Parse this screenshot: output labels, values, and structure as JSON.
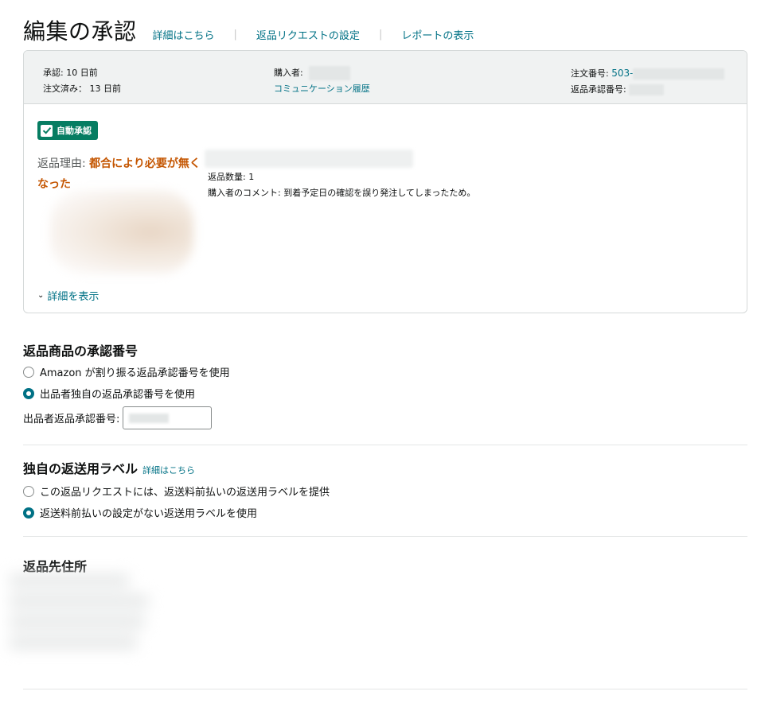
{
  "header": {
    "title": "編集の承認",
    "links": [
      "詳細はこちら",
      "返品リクエストの設定",
      "レポートの表示"
    ]
  },
  "card": {
    "approved": "承認: 10 日前",
    "ordered": "注文済み： 13 日前",
    "buyer_label": "購入者:",
    "communication_link": "コミュニケーション履歴",
    "order_number_label": "注文番号:",
    "order_number_prefix": "503-",
    "rma_label": "返品承認番号:",
    "badge": "自動承認",
    "reason_label": "返品理由:",
    "reason_value": "都合により必要が無くなった",
    "quantity": "返品数量: 1",
    "comment": "購入者のコメント: 到着予定日の確認を誤り発注してしまったため。",
    "show_details": "詳細を表示"
  },
  "rma_section": {
    "title": "返品商品の承認番号",
    "option_amazon": "Amazon が割り振る返品承認番号を使用",
    "option_seller": "出品者独自の返品承認番号を使用",
    "seller_rma_label": "出品者返品承認番号:",
    "selected": "seller"
  },
  "label_section": {
    "title": "独自の返送用ラベル",
    "details_link": "詳細はこちら",
    "option_prepaid": "この返品リクエストには、返送料前払いの返送用ラベルを提供",
    "option_unpaid": "返送料前払いの設定がない返送用ラベルを使用",
    "selected": "unpaid"
  },
  "address_section": {
    "title": "返品先住所"
  },
  "colors": {
    "link": "#007185",
    "badge": "#067d62",
    "reason": "#c45500"
  }
}
